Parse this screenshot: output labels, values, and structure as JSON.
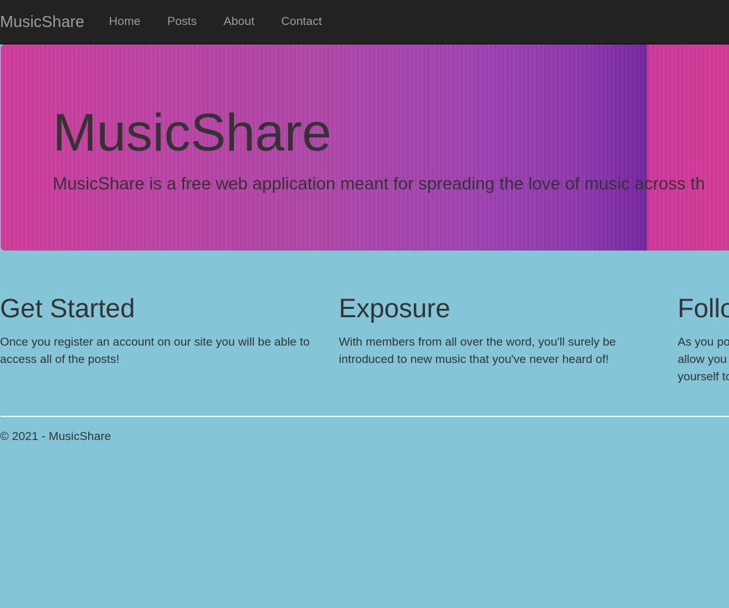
{
  "navbar": {
    "brand": "MusicShare",
    "links": [
      {
        "label": "Home"
      },
      {
        "label": "Posts"
      },
      {
        "label": "About"
      },
      {
        "label": "Contact"
      }
    ]
  },
  "jumbotron": {
    "title": "MusicShare",
    "lead": "MusicShare is a free web application meant for spreading the love of music across th"
  },
  "features": [
    {
      "title": "Get Started",
      "text": "Once you register an account on our site you will be able to access all of the posts!"
    },
    {
      "title": "Exposure",
      "text": "With members from all over the word, you'll surely be introduced to new music that you've never heard of!"
    },
    {
      "title": "Follo",
      "lines": [
        "As you po",
        "allow you",
        "yourself to"
      ]
    }
  ],
  "footer": {
    "copyright": "© 2021 - MusicShare"
  },
  "colors": {
    "navbar_bg": "#222222",
    "nav_text": "#9d9d9d",
    "page_bg": "#84c6d8",
    "jumbotron_start": "#d4349a",
    "jumbotron_end": "#78289f",
    "text": "#333333"
  }
}
